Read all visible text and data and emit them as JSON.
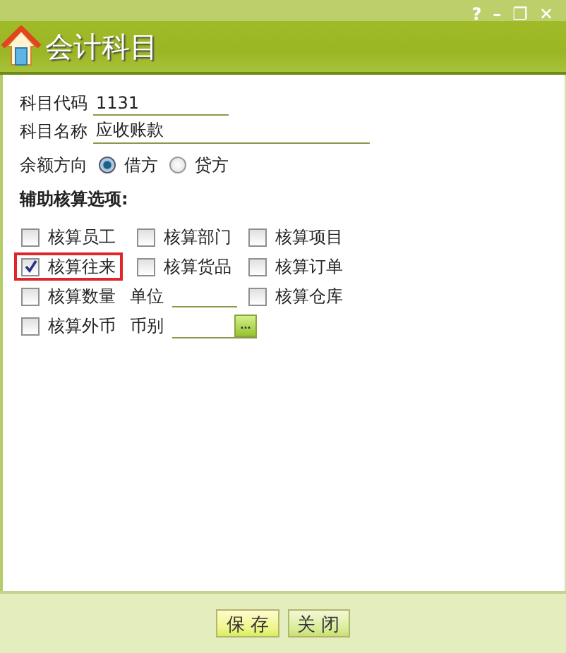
{
  "window": {
    "title": "会计科目",
    "controls": [
      "?",
      "–",
      "❐",
      "✕"
    ]
  },
  "fields": [
    {
      "label": "科目代码",
      "value": "1131"
    },
    {
      "label": "科目名称",
      "value": "应收账款"
    }
  ],
  "balance": {
    "label": "余额方向",
    "options": [
      {
        "label": "借方",
        "selected": true
      },
      {
        "label": "贷方",
        "selected": false
      }
    ]
  },
  "aux_title": "辅助核算选项:",
  "aux_rows": [
    [
      {
        "kind": "checkbox",
        "label": "核算员工",
        "checked": false,
        "highlighted": false
      },
      {
        "kind": "checkbox",
        "label": "核算部门",
        "checked": false,
        "highlighted": false
      },
      {
        "kind": "checkbox",
        "label": "核算项目",
        "checked": false,
        "highlighted": false
      }
    ],
    [
      {
        "kind": "checkbox",
        "label": "核算往来",
        "checked": true,
        "highlighted": true
      },
      {
        "kind": "checkbox",
        "label": "核算货品",
        "checked": false,
        "highlighted": false
      },
      {
        "kind": "checkbox",
        "label": "核算订单",
        "checked": false,
        "highlighted": false
      }
    ],
    [
      {
        "kind": "checkbox",
        "label": "核算数量",
        "checked": false,
        "highlighted": false
      },
      {
        "kind": "field",
        "label": "单位"
      },
      {
        "kind": "checkbox",
        "label": "核算仓库",
        "checked": false,
        "highlighted": false
      }
    ],
    [
      {
        "kind": "checkbox",
        "label": "核算外币",
        "checked": false,
        "highlighted": false
      },
      {
        "kind": "picker",
        "label": "币别",
        "button": "..."
      }
    ]
  ],
  "buttons": [
    "保 存",
    "关 闭"
  ]
}
